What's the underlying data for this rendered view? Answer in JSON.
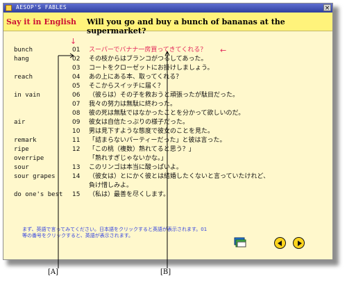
{
  "app": {
    "title": "AESOP'S FABLES",
    "close_label": "×"
  },
  "header": {
    "brand": "Say it in English",
    "question": "Will you go and buy a bunch of bananas at the supermarket?"
  },
  "rows": [
    {
      "term": "bunch",
      "number": "01",
      "japanese": "スーパーでバナナ一房買ってきてくれる？",
      "highlight": true
    },
    {
      "term": "hang",
      "number": "02",
      "japanese": "その枝からはブランコがつるしてあった。"
    },
    {
      "term": "",
      "number": "03",
      "japanese": "コートをクローゼットにお掛けしましょう。"
    },
    {
      "term": "reach",
      "number": "04",
      "japanese": "あの上にある本、取ってくれる？"
    },
    {
      "term": "",
      "number": "05",
      "japanese": "そこからスイッチに届く？"
    },
    {
      "term": "in vain",
      "number": "06",
      "japanese": "（彼らは）その子を救おうと頑張ったが駄目だった。"
    },
    {
      "term": "",
      "number": "07",
      "japanese": "我々の努力は無駄に終わった。"
    },
    {
      "term": "",
      "number": "08",
      "japanese": "彼の死は無駄ではなかったことを分かって欲しいのだ。"
    },
    {
      "term": "air",
      "number": "09",
      "japanese": "彼女は自信たっぷりの様子だった。"
    },
    {
      "term": "",
      "number": "10",
      "japanese": "男は見下すような態度で彼女のことを見た。"
    },
    {
      "term": "remark",
      "number": "11",
      "japanese": "「詰まらないパーティーだった」と彼は言った。"
    },
    {
      "term": "ripe",
      "number": "12",
      "japanese": "「この桃（複数）熟れてると思う？」"
    },
    {
      "term": "overripe",
      "number": "",
      "japanese": "「熟れすぎじゃないかな。」"
    },
    {
      "term": "sour",
      "number": "13",
      "japanese": "このリンゴは本当に酸っぱいよ。"
    },
    {
      "term": "sour grapes",
      "number": "14",
      "japanese": "（彼女は）とにかく彼とは結婚したくないと言っていたけれど、"
    },
    {
      "term": "",
      "number": "",
      "japanese": "負け惜しみよ。"
    },
    {
      "term": "do one's best",
      "number": "15",
      "japanese": "（私は）最善を尽くします。"
    }
  ],
  "instructions": "まず、英語で言ってみてください。日本語をクリックすると英語が表示されます。01等の番号をクリックすると、英語が表示されます。",
  "labels": {
    "a": "[A]",
    "b": "[B]"
  },
  "icons": {
    "book": "book-icon",
    "prev": "previous-arrow-icon",
    "next": "next-arrow-icon",
    "marker": "down-arrow-marker-icon"
  },
  "colors": {
    "header_bg": "#fff37b",
    "content_bg": "#fff8cc",
    "accent": "#e3285a",
    "title_bar": "#2f3f9e",
    "nav_yellow": "#ffd51c"
  }
}
